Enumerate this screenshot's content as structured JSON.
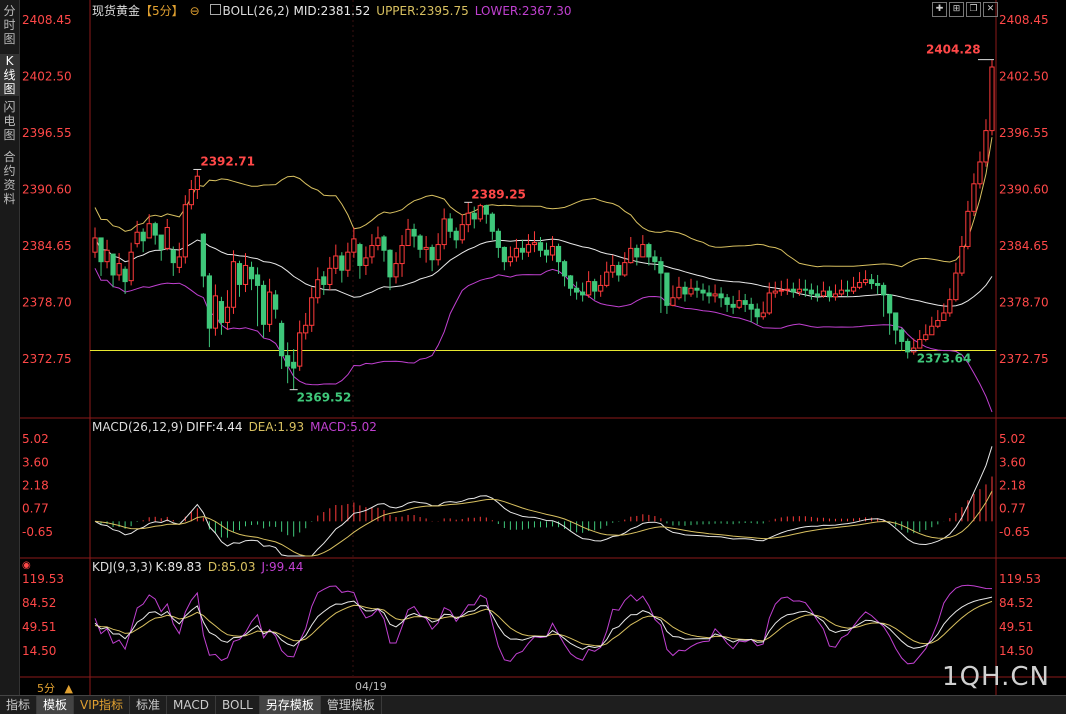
{
  "sidebar": {
    "tabs": [
      {
        "label": "分时图",
        "active": false
      },
      {
        "label": "K线图",
        "active": true
      },
      {
        "label": "闪电图",
        "active": false
      },
      {
        "label": "合约资料",
        "active": false
      }
    ]
  },
  "header": {
    "symbol": "现货黄金",
    "period": "【5分】",
    "indicator": "BOLL(26,2)",
    "mid": "MID:2381.52",
    "upper": "UPPER:2395.75",
    "lower": "LOWER:2367.30"
  },
  "macd_legend": {
    "name": "MACD(26,12,9)",
    "diff": "DIFF:4.44",
    "dea": "DEA:1.93",
    "macd": "MACD:5.02"
  },
  "kdj_legend": {
    "name": "KDJ(9,3,3)",
    "k": "K:89.83",
    "d": "D:85.03",
    "j": "J:99.44"
  },
  "axes": {
    "price_ticks": [
      "2408.45",
      "2402.50",
      "2396.55",
      "2390.60",
      "2384.65",
      "2378.70",
      "2372.75"
    ],
    "price_tick_values": [
      2408.45,
      2402.5,
      2396.55,
      2390.6,
      2384.65,
      2378.7,
      2372.75
    ],
    "macd_ticks": [
      "5.02",
      "3.60",
      "2.18",
      "0.77",
      "-0.65"
    ],
    "macd_tick_values": [
      5.02,
      3.6,
      2.18,
      0.77,
      -0.65
    ],
    "kdj_ticks": [
      "119.53",
      "84.52",
      "49.51",
      "14.50"
    ],
    "kdj_tick_values": [
      119.53,
      84.52,
      49.51,
      14.5
    ],
    "date_label": "04/19",
    "period_label": "5分"
  },
  "annotations": {
    "high1": "2392.71",
    "high2": "2389.25",
    "high3": "2404.28",
    "low1": "2369.52",
    "low2": "2373.64",
    "hline_value": 2373.64
  },
  "colors": {
    "up": "#ff3b3b",
    "down": "#3fc77a",
    "mid": "#e8e8e8",
    "upper": "#d8c060",
    "lower": "#c040d0",
    "hline": "#e8e830",
    "label_red": "#ff4848",
    "label_green": "#3fc77a"
  },
  "bottom_tabs": [
    {
      "label": "指标",
      "active": false,
      "vip": false
    },
    {
      "label": "模板",
      "active": true,
      "vip": false
    },
    {
      "label": "VIP指标",
      "active": false,
      "vip": true
    },
    {
      "label": "标准",
      "active": false,
      "vip": false
    },
    {
      "label": "MACD",
      "active": false,
      "vip": false
    },
    {
      "label": "BOLL",
      "active": false,
      "vip": false
    },
    {
      "label": "另存模板",
      "active": true,
      "vip": false
    },
    {
      "label": "管理模板",
      "active": false,
      "vip": false
    }
  ],
  "watermark": "1QH.CN",
  "chart_data": {
    "type": "candlestick",
    "title": "现货黄金",
    "period": "5分",
    "closes": [
      2385.5,
      2383.0,
      2384.2,
      2381.6,
      2382.8,
      2380.9,
      2384.0,
      2386.1,
      2385.2,
      2387.0,
      2385.8,
      2384.3,
      2386.6,
      2382.9,
      2383.5,
      2389.0,
      2390.6,
      2392.0,
      2381.5,
      2376.0,
      2379.4,
      2376.6,
      2378.2,
      2383.0,
      2380.6,
      2382.6,
      2381.2,
      2380.5,
      2376.4,
      2379.8,
      2378.0,
      2373.1,
      2372.0,
      2371.8,
      2375.5,
      2376.3,
      2379.2,
      2381.1,
      2380.6,
      2382.3,
      2383.6,
      2382.1,
      2384.0,
      2385.4,
      2382.6,
      2383.4,
      2384.7,
      2385.5,
      2384.2,
      2381.4,
      2382.8,
      2384.7,
      2386.4,
      2385.7,
      2384.3,
      2384.5,
      2383.2,
      2384.8,
      2387.5,
      2386.2,
      2385.3,
      2386.9,
      2388.1,
      2387.5,
      2388.9,
      2388.0,
      2386.2,
      2384.5,
      2383.0,
      2383.5,
      2384.4,
      2384.0,
      2384.8,
      2385.0,
      2384.2,
      2383.7,
      2384.6,
      2383.0,
      2381.5,
      2380.2,
      2379.8,
      2379.5,
      2380.9,
      2379.9,
      2380.5,
      2381.9,
      2382.6,
      2381.6,
      2382.9,
      2384.4,
      2383.5,
      2384.8,
      2383.5,
      2383.0,
      2381.8,
      2378.4,
      2379.2,
      2380.3,
      2379.6,
      2380.2,
      2380.0,
      2379.7,
      2379.4,
      2379.6,
      2379.2,
      2378.5,
      2378.2,
      2378.9,
      2378.5,
      2378.0,
      2377.2,
      2377.6,
      2379.7,
      2379.9,
      2380.0,
      2380.1,
      2379.8,
      2380.1,
      2380.0,
      2379.6,
      2379.4,
      2379.9,
      2379.3,
      2379.6,
      2380.0,
      2379.9,
      2380.3,
      2380.8,
      2381.1,
      2380.7,
      2380.5,
      2379.5,
      2377.6,
      2375.8,
      2374.6,
      2373.5,
      2373.9,
      2374.8,
      2375.3,
      2376.2,
      2376.8,
      2377.6,
      2379.0,
      2381.8,
      2384.6,
      2388.3,
      2391.2,
      2393.5,
      2396.8,
      2403.5
    ],
    "highs": [
      2386.6,
      2384.5,
      2385.3,
      2383.2,
      2383.9,
      2382.5,
      2385.0,
      2387.3,
      2386.5,
      2388.0,
      2387.2,
      2385.8,
      2387.5,
      2384.6,
      2385.0,
      2390.0,
      2391.6,
      2392.71,
      2386.0,
      2381.8,
      2380.6,
      2379.3,
      2380.0,
      2384.2,
      2383.1,
      2383.9,
      2383.0,
      2382.4,
      2381.0,
      2381.2,
      2380.0,
      2376.8,
      2374.5,
      2373.8,
      2376.8,
      2377.6,
      2380.3,
      2382.4,
      2382.0,
      2383.5,
      2384.8,
      2384.0,
      2385.0,
      2386.6,
      2385.0,
      2384.6,
      2385.9,
      2386.7,
      2385.8,
      2384.3,
      2384.0,
      2385.8,
      2387.5,
      2387.0,
      2385.9,
      2385.7,
      2384.8,
      2386.0,
      2388.6,
      2388.1,
      2386.6,
      2388.0,
      2389.25,
      2388.8,
      2389.1,
      2389.0,
      2388.2,
      2386.5,
      2384.6,
      2384.6,
      2385.4,
      2385.3,
      2385.9,
      2386.2,
      2385.6,
      2385.0,
      2385.7,
      2384.9,
      2383.2,
      2381.6,
      2380.9,
      2380.8,
      2382.0,
      2381.2,
      2381.6,
      2383.0,
      2383.7,
      2383.0,
      2384.0,
      2385.6,
      2384.8,
      2385.8,
      2385.0,
      2384.2,
      2383.5,
      2381.0,
      2380.5,
      2381.4,
      2380.9,
      2381.2,
      2381.0,
      2380.7,
      2380.5,
      2380.6,
      2380.3,
      2379.6,
      2379.4,
      2380.0,
      2379.6,
      2379.2,
      2378.6,
      2378.8,
      2380.8,
      2380.9,
      2381.0,
      2381.2,
      2380.8,
      2381.2,
      2381.1,
      2380.7,
      2380.5,
      2380.9,
      2380.4,
      2380.6,
      2381.1,
      2381.0,
      2381.4,
      2381.9,
      2382.1,
      2381.7,
      2381.6,
      2380.8,
      2379.6,
      2377.4,
      2376.0,
      2374.9,
      2374.9,
      2375.8,
      2376.4,
      2377.2,
      2377.9,
      2378.6,
      2380.2,
      2382.9,
      2385.7,
      2389.4,
      2392.3,
      2394.6,
      2398.0,
      2404.28
    ],
    "lows": [
      2383.4,
      2381.5,
      2382.3,
      2380.3,
      2381.0,
      2379.6,
      2380.5,
      2384.5,
      2384.0,
      2385.6,
      2384.8,
      2383.1,
      2384.2,
      2381.5,
      2381.8,
      2382.8,
      2388.5,
      2389.6,
      2380.3,
      2374.0,
      2375.2,
      2375.3,
      2375.8,
      2377.5,
      2379.3,
      2379.8,
      2380.0,
      2376.2,
      2375.0,
      2375.6,
      2377.0,
      2371.7,
      2370.2,
      2369.52,
      2371.5,
      2374.8,
      2375.6,
      2378.6,
      2379.5,
      2380.0,
      2381.7,
      2380.8,
      2381.4,
      2383.4,
      2381.2,
      2381.6,
      2382.8,
      2384.2,
      2383.0,
      2380.0,
      2380.7,
      2381.4,
      2384.7,
      2384.5,
      2383.4,
      2382.9,
      2382.0,
      2382.6,
      2384.3,
      2385.5,
      2384.4,
      2384.9,
      2386.1,
      2386.5,
      2387.2,
      2387.0,
      2385.3,
      2383.4,
      2382.1,
      2382.5,
      2383.0,
      2383.2,
      2383.5,
      2384.0,
      2383.5,
      2382.9,
      2383.1,
      2381.7,
      2380.4,
      2379.4,
      2379.0,
      2378.8,
      2379.2,
      2379.0,
      2379.3,
      2380.3,
      2381.3,
      2380.9,
      2381.4,
      2382.8,
      2382.6,
      2383.6,
      2382.6,
      2382.1,
      2377.6,
      2377.5,
      2378.3,
      2379.0,
      2378.8,
      2379.3,
      2379.2,
      2378.9,
      2378.6,
      2378.7,
      2378.2,
      2377.7,
      2377.5,
      2378.0,
      2377.7,
      2376.6,
      2376.4,
      2376.9,
      2377.4,
      2379.2,
      2379.4,
      2379.5,
      2379.2,
      2379.4,
      2379.3,
      2379.0,
      2378.8,
      2379.2,
      2378.8,
      2378.9,
      2379.4,
      2379.3,
      2379.6,
      2380.1,
      2380.5,
      2380.1,
      2379.6,
      2377.2,
      2375.3,
      2374.3,
      2373.64,
      2372.8,
      2373.2,
      2374.0,
      2374.6,
      2375.5,
      2376.0,
      2376.9,
      2377.2,
      2378.8,
      2381.5,
      2384.3,
      2387.8,
      2390.7,
      2393.0,
      2396.3
    ],
    "opens": [
      2384.0,
      2385.5,
      2383.0,
      2383.8,
      2381.6,
      2382.2,
      2381.0,
      2384.9,
      2386.1,
      2385.5,
      2387.0,
      2385.8,
      2384.4,
      2384.2,
      2382.4,
      2383.5,
      2389.0,
      2390.6,
      2385.9,
      2381.5,
      2376.0,
      2378.8,
      2376.6,
      2378.2,
      2382.8,
      2380.6,
      2382.4,
      2381.6,
      2380.5,
      2376.4,
      2379.5,
      2376.5,
      2373.1,
      2372.4,
      2372.0,
      2375.5,
      2376.3,
      2379.2,
      2381.4,
      2380.6,
      2382.3,
      2383.6,
      2382.1,
      2384.0,
      2384.8,
      2382.6,
      2383.5,
      2384.7,
      2385.6,
      2384.2,
      2381.4,
      2382.8,
      2384.7,
      2386.4,
      2385.7,
      2384.3,
      2384.5,
      2383.2,
      2384.8,
      2387.5,
      2386.2,
      2385.3,
      2386.9,
      2388.1,
      2387.5,
      2388.9,
      2388.0,
      2386.2,
      2384.5,
      2383.0,
      2383.5,
      2384.4,
      2384.0,
      2384.8,
      2385.0,
      2384.2,
      2383.7,
      2384.6,
      2383.0,
      2381.5,
      2380.2,
      2379.8,
      2379.5,
      2380.9,
      2379.9,
      2380.5,
      2381.9,
      2382.6,
      2381.6,
      2382.9,
      2384.4,
      2383.5,
      2384.8,
      2383.5,
      2383.0,
      2381.8,
      2378.4,
      2379.2,
      2380.3,
      2379.6,
      2380.2,
      2380.0,
      2379.7,
      2379.4,
      2379.6,
      2379.2,
      2378.5,
      2378.2,
      2378.9,
      2378.5,
      2378.0,
      2377.2,
      2377.6,
      2379.7,
      2379.9,
      2380.0,
      2380.1,
      2379.8,
      2380.1,
      2380.0,
      2379.6,
      2379.4,
      2379.9,
      2379.3,
      2379.6,
      2380.0,
      2379.9,
      2380.3,
      2380.8,
      2381.1,
      2380.7,
      2380.5,
      2379.5,
      2377.6,
      2375.8,
      2374.6,
      2373.5,
      2373.9,
      2374.8,
      2375.3,
      2376.2,
      2376.8,
      2377.6,
      2379.0,
      2381.8,
      2384.6,
      2388.3,
      2391.2,
      2393.5,
      2396.8
    ]
  }
}
